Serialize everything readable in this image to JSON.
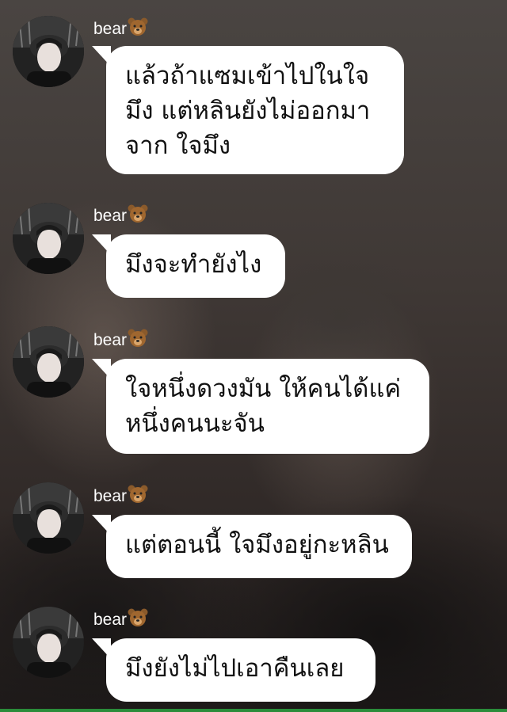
{
  "messages": [
    {
      "sender": "bear",
      "lines": [
        "แล้วถ้าแซมเข้าไปในใจ",
        "มึง แต่หลินยังไม่ออกมา",
        "จาก ใจมึง"
      ]
    },
    {
      "sender": "bear",
      "lines": [
        "มึงจะทำยังไง"
      ]
    },
    {
      "sender": "bear",
      "lines": [
        " ใจหนึ่งดวงมัน ให้คนได้แค่",
        "หนึ่งคนนะจัน"
      ]
    },
    {
      "sender": "bear",
      "lines": [
        "แต่ตอนนี้ ใจมึงอยู่กะหลิน"
      ]
    },
    {
      "sender": "bear",
      "lines": [
        "มึงยังไม่ไปเอาคืนเลย"
      ]
    }
  ],
  "icons": {
    "sender_emoji": "bear-face-icon",
    "avatar": "avatar-photo"
  },
  "colors": {
    "bubble": "#ffffff",
    "text": "#111111",
    "sender_name": "#ffffff",
    "bottom_accent": "#2a8c3a"
  }
}
